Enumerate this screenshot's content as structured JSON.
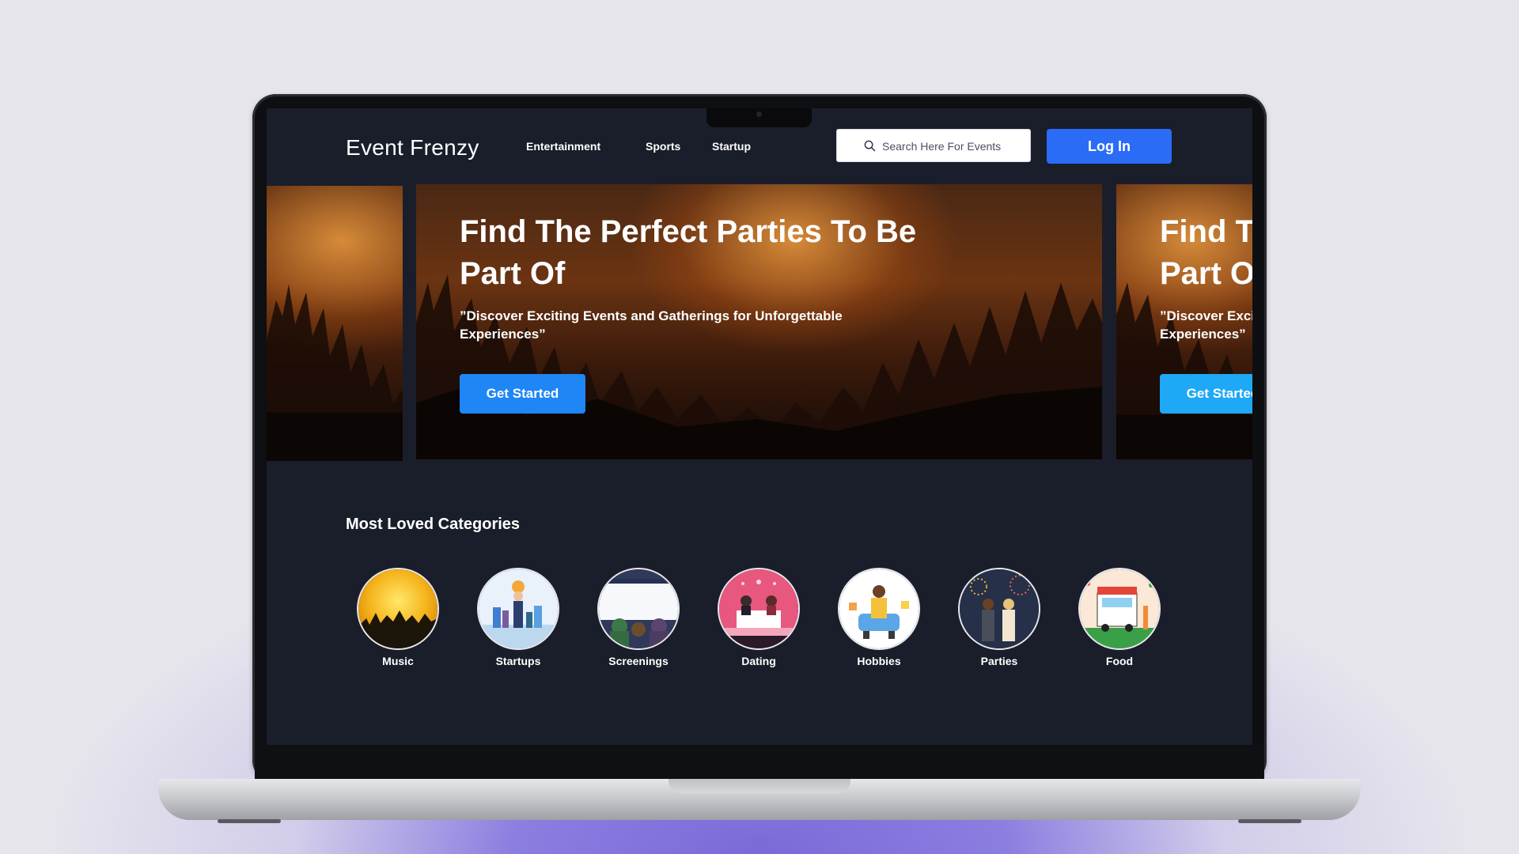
{
  "app": {
    "logo": "Event Frenzy"
  },
  "nav": {
    "items": [
      "Entertainment",
      "Sports",
      "Startup"
    ]
  },
  "search": {
    "placeholder": "Search Here For Events"
  },
  "auth": {
    "login_label": "Log In"
  },
  "hero": {
    "title": "Find The Perfect Parties To Be Part Of",
    "subtitle": "”Discover Exciting Events and Gatherings for Unforgettable Experiences”",
    "cta_label": "Get Started",
    "right_peek": {
      "title": "Find The Perfect Parties To Be Part Of",
      "subtitle": "”Discover Exciting Events and Gatherings for Unforgettable Experiences”",
      "cta_label": "Get Started"
    }
  },
  "categories": {
    "title": "Most Loved Categories",
    "items": [
      {
        "label": "Music",
        "icon": "music-icon"
      },
      {
        "label": "Startups",
        "icon": "startups-icon"
      },
      {
        "label": "Screenings",
        "icon": "screenings-icon"
      },
      {
        "label": "Dating",
        "icon": "dating-icon"
      },
      {
        "label": "Hobbies",
        "icon": "hobbies-icon"
      },
      {
        "label": "Parties",
        "icon": "parties-icon"
      },
      {
        "label": "Food",
        "icon": "food-icon"
      }
    ]
  },
  "colors": {
    "accent": "#2a6cf6",
    "cta": "#1f86f5",
    "background": "#1a1e2a"
  }
}
